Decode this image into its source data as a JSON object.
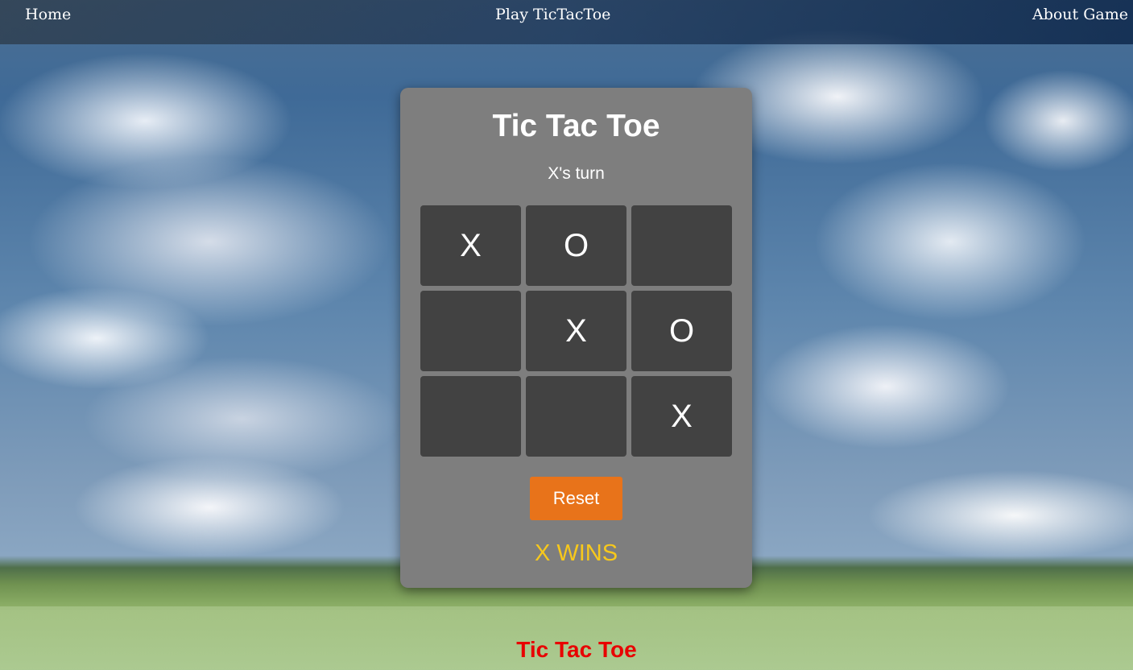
{
  "nav": {
    "home": "Home",
    "play": "Play TicTacToe",
    "about": "About Game"
  },
  "game": {
    "title": "Tic Tac Toe",
    "turn": "X's turn",
    "board": [
      [
        "X",
        "O",
        ""
      ],
      [
        "",
        "X",
        "O"
      ],
      [
        "",
        "",
        "X"
      ]
    ],
    "reset_label": "Reset",
    "result": "X WINS"
  },
  "footer": {
    "text": "Tic Tac Toe"
  },
  "colors": {
    "card": "#7e7e7e",
    "cell": "#424242",
    "reset_button": "#e8731a",
    "result_text": "#f7c81c",
    "footer_text": "#e80000"
  }
}
